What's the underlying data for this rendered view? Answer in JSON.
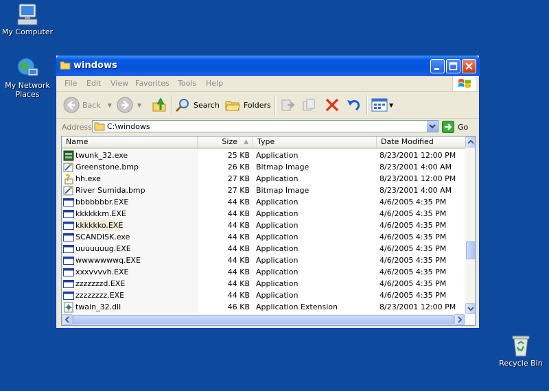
{
  "desktop": {
    "icons": [
      {
        "label": "My Computer"
      },
      {
        "label": "My Network Places"
      },
      {
        "label": "Recycle Bin"
      }
    ]
  },
  "window": {
    "title": "windows",
    "menu": [
      "File",
      "Edit",
      "View",
      "Favorites",
      "Tools",
      "Help"
    ],
    "toolbar": {
      "back_label": "Back",
      "search_label": "Search",
      "folders_label": "Folders"
    },
    "address": {
      "label": "Address",
      "value": "C:\\windows",
      "go_label": "Go"
    },
    "columns": {
      "name": "Name",
      "size": "Size",
      "type": "Type",
      "date": "Date Modified"
    },
    "files": [
      {
        "name": "twunk_32.exe",
        "size": "25 KB",
        "type": "Application",
        "date": "8/23/2001 12:00 PM",
        "icon": "app-green-icon"
      },
      {
        "name": "Greenstone.bmp",
        "size": "26 KB",
        "type": "Bitmap Image",
        "date": "8/23/2001 4:00 AM",
        "icon": "bitmap-icon"
      },
      {
        "name": "hh.exe",
        "size": "27 KB",
        "type": "Application",
        "date": "8/23/2001 12:00 PM",
        "icon": "help-icon"
      },
      {
        "name": "River Sumida.bmp",
        "size": "27 KB",
        "type": "Bitmap Image",
        "date": "8/23/2001 4:00 AM",
        "icon": "bitmap-icon"
      },
      {
        "name": "bbbbbbbr.EXE",
        "size": "44 KB",
        "type": "Application",
        "date": "4/6/2005 4:35 PM",
        "icon": "app-window-icon"
      },
      {
        "name": "kkkkkkm.EXE",
        "size": "44 KB",
        "type": "Application",
        "date": "4/6/2005 4:35 PM",
        "icon": "app-window-icon"
      },
      {
        "name": "kkkkkko.EXE",
        "size": "44 KB",
        "type": "Application",
        "date": "4/6/2005 4:35 PM",
        "icon": "app-window-icon"
      },
      {
        "name": "SCANDISK.exe",
        "size": "44 KB",
        "type": "Application",
        "date": "4/6/2005 4:35 PM",
        "icon": "app-window-icon"
      },
      {
        "name": "uuuuuuug.EXE",
        "size": "44 KB",
        "type": "Application",
        "date": "4/6/2005 4:35 PM",
        "icon": "app-window-icon"
      },
      {
        "name": "wwwwwwwq.EXE",
        "size": "44 KB",
        "type": "Application",
        "date": "4/6/2005 4:35 PM",
        "icon": "app-window-icon"
      },
      {
        "name": "xxxvvvvh.EXE",
        "size": "44 KB",
        "type": "Application",
        "date": "4/6/2005 4:35 PM",
        "icon": "app-window-icon"
      },
      {
        "name": "zzzzzzzd.EXE",
        "size": "44 KB",
        "type": "Application",
        "date": "4/6/2005 4:35 PM",
        "icon": "app-window-icon"
      },
      {
        "name": "zzzzzzzz.EXE",
        "size": "44 KB",
        "type": "Application",
        "date": "4/6/2005 4:35 PM",
        "icon": "app-window-icon"
      },
      {
        "name": "twain_32.dll",
        "size": "46 KB",
        "type": "Application Extension",
        "date": "8/23/2001 12:00 PM",
        "icon": "dll-icon"
      }
    ],
    "selected_index": 6
  },
  "colors": {
    "desktop": "#0d4a9e",
    "titlebar": "#0453d8"
  }
}
